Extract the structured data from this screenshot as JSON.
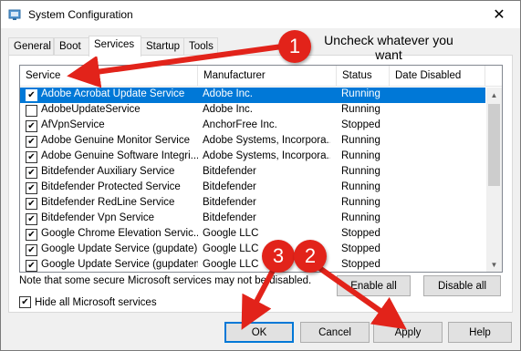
{
  "window": {
    "title": "System Configuration",
    "close_glyph": "✕"
  },
  "tabs": [
    {
      "label": "General"
    },
    {
      "label": "Boot"
    },
    {
      "label": "Services"
    },
    {
      "label": "Startup"
    },
    {
      "label": "Tools"
    }
  ],
  "list": {
    "columns": [
      "Service",
      "Manufacturer",
      "Status",
      "Date Disabled"
    ],
    "rows": [
      {
        "checked": true,
        "service": "Adobe Acrobat Update Service",
        "manufacturer": "Adobe Inc.",
        "status": "Running",
        "date_disabled": "",
        "selected": true
      },
      {
        "checked": false,
        "service": "AdobeUpdateService",
        "manufacturer": "Adobe Inc.",
        "status": "Running",
        "date_disabled": ""
      },
      {
        "checked": true,
        "service": "AfVpnService",
        "manufacturer": "AnchorFree Inc.",
        "status": "Stopped",
        "date_disabled": ""
      },
      {
        "checked": true,
        "service": "Adobe Genuine Monitor Service",
        "manufacturer": "Adobe Systems, Incorpora...",
        "status": "Running",
        "date_disabled": ""
      },
      {
        "checked": true,
        "service": "Adobe Genuine Software Integri...",
        "manufacturer": "Adobe Systems, Incorpora...",
        "status": "Running",
        "date_disabled": ""
      },
      {
        "checked": true,
        "service": "Bitdefender Auxiliary Service",
        "manufacturer": "Bitdefender",
        "status": "Running",
        "date_disabled": ""
      },
      {
        "checked": true,
        "service": "Bitdefender Protected Service",
        "manufacturer": "Bitdefender",
        "status": "Running",
        "date_disabled": ""
      },
      {
        "checked": true,
        "service": "Bitdefender RedLine Service",
        "manufacturer": "Bitdefender",
        "status": "Running",
        "date_disabled": ""
      },
      {
        "checked": true,
        "service": "Bitdefender Vpn Service",
        "manufacturer": "Bitdefender",
        "status": "Running",
        "date_disabled": ""
      },
      {
        "checked": true,
        "service": "Google Chrome Elevation Servic...",
        "manufacturer": "Google LLC",
        "status": "Stopped",
        "date_disabled": ""
      },
      {
        "checked": true,
        "service": "Google Update Service (gupdate)",
        "manufacturer": "Google LLC",
        "status": "Stopped",
        "date_disabled": ""
      },
      {
        "checked": true,
        "service": "Google Update Service (gupdatem)",
        "manufacturer": "Google LLC",
        "status": "Stopped",
        "date_disabled": ""
      }
    ],
    "checkmark": "✔"
  },
  "note": "Note that some secure Microsoft services may not be disabled.",
  "buttons": {
    "enable_all": "Enable all",
    "disable_all": "Disable all",
    "ok": "OK",
    "cancel": "Cancel",
    "apply": "Apply",
    "help": "Help"
  },
  "hide_ms": {
    "label": "Hide all Microsoft services",
    "checked": true
  },
  "annotations": {
    "step1": "1",
    "step2": "2",
    "step3": "3",
    "instruction": "Uncheck whatever you want",
    "color": "#e2231a"
  },
  "colors": {
    "selection": "#0078d7",
    "accent": "#0078d7"
  }
}
